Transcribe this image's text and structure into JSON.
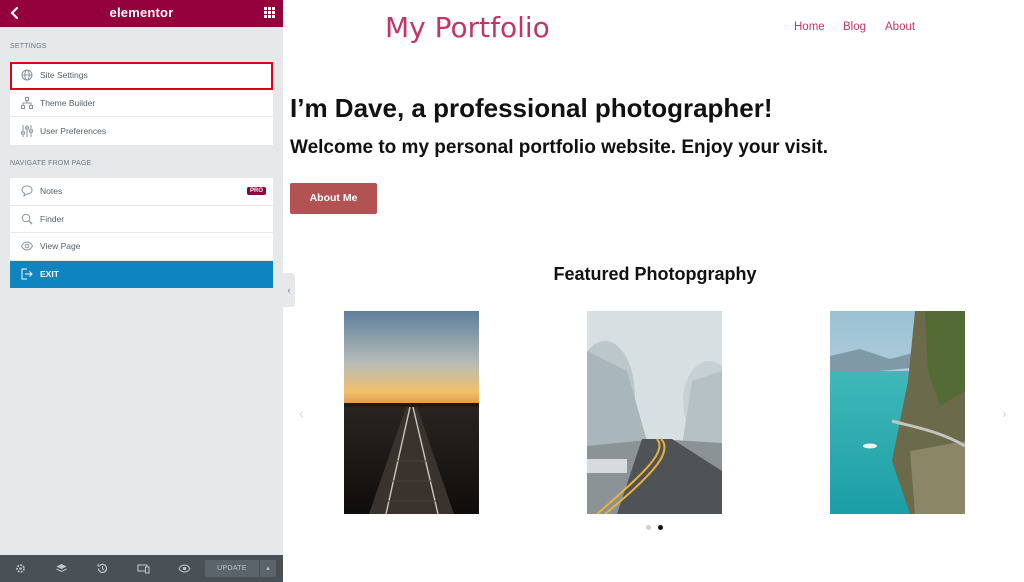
{
  "editor": {
    "title": "elementor",
    "settings_label": "SETTINGS",
    "settings_items": [
      {
        "label": "Site Settings",
        "icon": "globe-icon"
      },
      {
        "label": "Theme Builder",
        "icon": "sitemap-icon"
      },
      {
        "label": "User Preferences",
        "icon": "sliders-icon"
      }
    ],
    "navigate_label": "NAVIGATE FROM PAGE",
    "navigate_items": [
      {
        "label": "Notes",
        "icon": "comment-icon",
        "badge": "PRO"
      },
      {
        "label": "Finder",
        "icon": "search-icon"
      },
      {
        "label": "View Page",
        "icon": "eye-icon"
      },
      {
        "label": "EXIT",
        "icon": "exit-icon"
      }
    ],
    "footer": {
      "update_label": "UPDATE",
      "icons": [
        "settings-icon",
        "layers-icon",
        "history-icon",
        "responsive-icon",
        "preview-icon"
      ]
    },
    "colors": {
      "brand": "#93003c",
      "exit": "#0e84c0",
      "highlight": "#e0001a"
    }
  },
  "site": {
    "title": "My Portfolio",
    "nav": [
      "Home",
      "Blog",
      "About"
    ],
    "hero_heading": "I’m Dave, a professional photographer!",
    "hero_sub": "Welcome to my personal portfolio website. Enjoy your visit.",
    "cta_label": "About Me",
    "featured_heading": "Featured Photopgraphy",
    "photos": [
      {
        "subject": "railway track at sunset"
      },
      {
        "subject": "winding road through frosted trees"
      },
      {
        "subject": "coastal cliff road over turquoise lake"
      }
    ],
    "carousel": {
      "pages": 2,
      "active": 2
    },
    "colors": {
      "accent": "#c0356b",
      "button": "#b35252"
    }
  }
}
